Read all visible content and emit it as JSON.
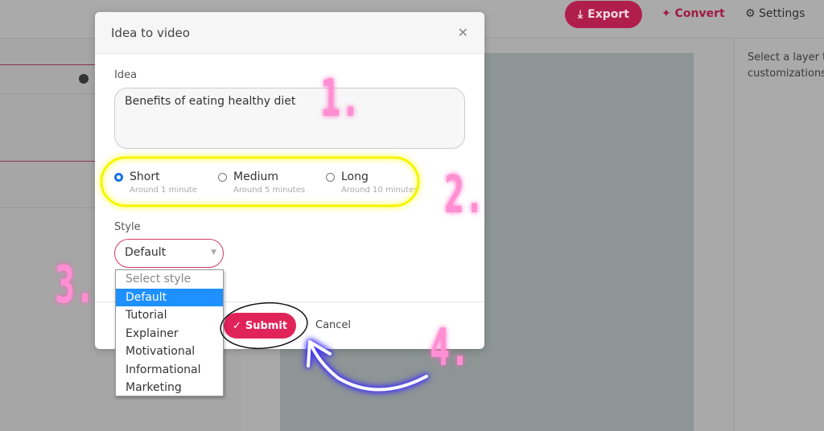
{
  "topbar": {
    "export_label": "Export",
    "convert_label": "Convert",
    "settings_label": "Settings"
  },
  "right_panel": {
    "hint_line1": "Select a layer t",
    "hint_line2": "customizations"
  },
  "modal": {
    "title": "Idea to video",
    "close_icon": "close-icon",
    "idea_label": "Idea",
    "idea_value": "Benefits of eating healthy diet",
    "lengths": [
      {
        "label": "Short",
        "sub": "Around 1 minute",
        "checked": true
      },
      {
        "label": "Medium",
        "sub": "Around 5 minutes",
        "checked": false
      },
      {
        "label": "Long",
        "sub": "Around 10 minutes",
        "checked": false
      }
    ],
    "style_label": "Style",
    "style_value": "Default",
    "style_options": [
      "Select style",
      "Default",
      "Tutorial",
      "Explainer",
      "Motivational",
      "Informational",
      "Marketing"
    ],
    "submit_label": "Submit",
    "cancel_label": "Cancel"
  },
  "annotations": {
    "step1": "1.",
    "step2": "2.",
    "step3": "3.",
    "step4": "4.",
    "colors": {
      "numbers": "#ff8fd2",
      "highlight": "#f5f500",
      "arrow": "#3a2bff"
    }
  },
  "colors": {
    "accent": "#e0245a",
    "selected_option": "#1e90ff"
  }
}
